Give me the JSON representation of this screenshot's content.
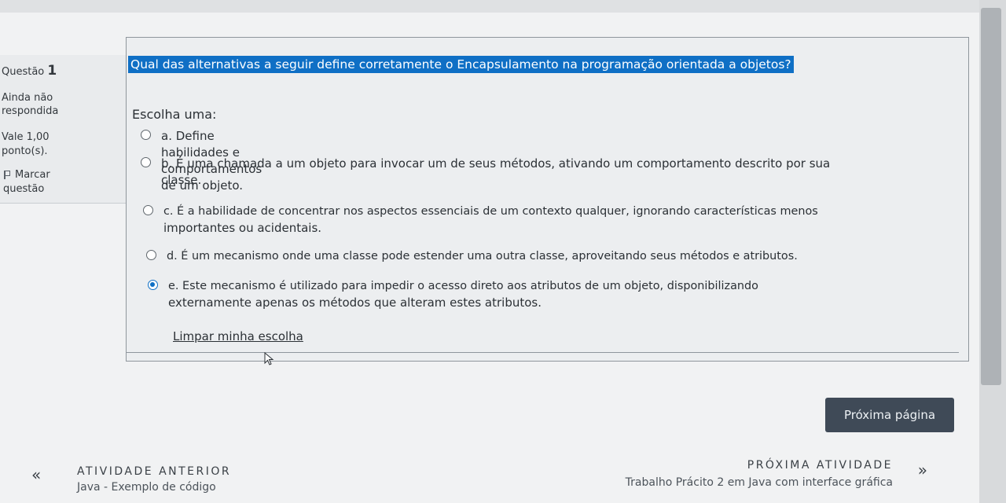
{
  "sidebar_info": {
    "question_prefix": "Questão",
    "question_number": "1",
    "status_line1": "Ainda não",
    "status_line2": "respondida",
    "grade_line1": "Vale 1,00",
    "grade_line2": "ponto(s).",
    "flag_line1": "Marcar",
    "flag_line2": "questão"
  },
  "question": {
    "text": "Qual das alternativas a seguir define corretamente o Encapsulamento na programação orientada a objetos?",
    "choose_label": "Escolha uma:",
    "options": [
      {
        "line1": "a. Define habilidades e comportamentos de um objeto.",
        "line2": "",
        "selected": false
      },
      {
        "line1": "b. É uma chamada a um objeto para invocar um de seus métodos, ativando um comportamento descrito por sua",
        "line2": "classe.",
        "selected": false
      },
      {
        "line1": "c. É a habilidade de concentrar nos aspectos essenciais de um contexto qualquer, ignorando características menos",
        "line2": "importantes ou acidentais.",
        "selected": false
      },
      {
        "line1": "d. É um mecanismo onde uma classe pode estender uma outra classe, aproveitando seus métodos e atributos.",
        "line2": "",
        "selected": false
      },
      {
        "line1": "e. Este mecanismo é utilizado para impedir o acesso direto aos atributos de um objeto, disponibilizando",
        "line2": "externamente apenas os métodos que alteram estes atributos.",
        "selected": true
      }
    ],
    "clear_label": "Limpar minha escolha"
  },
  "footer": {
    "next_page_label": "Próxima página",
    "prev_activity_kicker": "ATIVIDADE ANTERIOR",
    "prev_activity_name": "Java - Exemplo de código",
    "next_activity_kicker": "PRÓXIMA ATIVIDADE",
    "next_activity_name": "Trabalho Prácito 2 em Java com interface gráfica",
    "prev_chevron": "«",
    "next_chevron": "»"
  },
  "icons": [
    "flag-icon",
    "radio-icon",
    "mouse-cursor-icon",
    "double-chevron-left-icon",
    "double-chevron-right-icon"
  ],
  "colors": {
    "accent": "#0f6fc5",
    "button": "#3f4a57"
  }
}
